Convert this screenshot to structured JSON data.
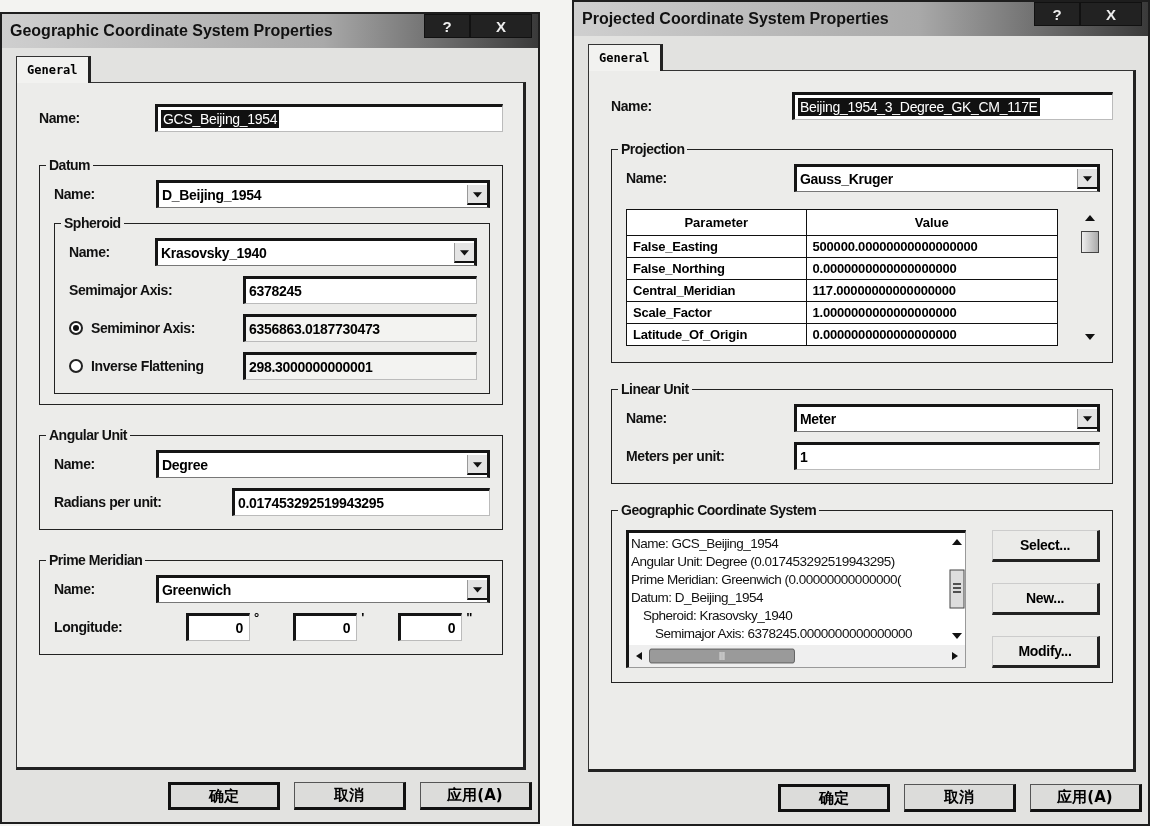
{
  "dialogs": [
    {
      "title": "Geographic Coordinate System Properties",
      "title_buttons": [
        "?",
        "X"
      ],
      "tabs": [
        {
          "label": "General",
          "selected": true
        }
      ],
      "name": {
        "label": "Name:",
        "value": "GCS_Beijing_1954",
        "text_selected": true
      },
      "groups": [
        {
          "title": "Datum",
          "rows": [
            {
              "kind": "dropdown",
              "label": "Name:",
              "value": "D_Beijing_1954"
            },
            {
              "kind": "group",
              "title": "Spheroid",
              "rows": [
                {
                  "kind": "dropdown",
                  "label": "Name:",
                  "value": "Krasovsky_1940"
                },
                {
                  "kind": "field",
                  "label": "Semimajor Axis:",
                  "value": "6378245"
                },
                {
                  "kind": "radio",
                  "label": "Semiminor Axis:",
                  "value": "6356863.0187730473",
                  "selected": true
                },
                {
                  "kind": "radio",
                  "label": "Inverse Flattening",
                  "value": "298.3000000000001",
                  "selected": false
                }
              ]
            }
          ]
        },
        {
          "title": "Angular Unit",
          "rows": [
            {
              "kind": "dropdown",
              "label": "Name:",
              "value": "Degree"
            },
            {
              "kind": "field",
              "label": "Radians per unit:",
              "value": "0.017453292519943295"
            }
          ]
        },
        {
          "title": "Prime Meridian",
          "rows": [
            {
              "kind": "dropdown",
              "label": "Name:",
              "value": "Greenwich"
            },
            {
              "kind": "dms",
              "label": "Longitude:",
              "fields": [
                {
                  "value": "0",
                  "unit": "°"
                },
                {
                  "value": "0",
                  "unit": "'"
                },
                {
                  "value": "0",
                  "unit": "\""
                }
              ]
            }
          ]
        }
      ],
      "buttons": [
        {
          "label": "确定",
          "default": true
        },
        {
          "label": "取消",
          "default": false
        },
        {
          "label": "应用(A)",
          "default": false
        }
      ]
    },
    {
      "title": "Projected Coordinate System Properties",
      "title_buttons": [
        "?",
        "X"
      ],
      "tabs": [
        {
          "label": "General",
          "selected": true
        }
      ],
      "name": {
        "label": "Name:",
        "value": "Beijing_1954_3_Degree_GK_CM_117E",
        "text_selected": true
      },
      "groups": [
        {
          "title": "Projection",
          "rows": [
            {
              "kind": "dropdown",
              "label": "Name:",
              "value": "Gauss_Kruger"
            },
            {
              "kind": "table",
              "columns": [
                "Parameter",
                "Value"
              ],
              "rows": [
                [
                  "False_Easting",
                  "500000.00000000000000000"
                ],
                [
                  "False_Northing",
                  "0.0000000000000000000"
                ],
                [
                  "Central_Meridian",
                  "117.00000000000000000"
                ],
                [
                  "Scale_Factor",
                  "1.0000000000000000000"
                ],
                [
                  "Latitude_Of_Origin",
                  "0.0000000000000000000"
                ]
              ]
            }
          ]
        },
        {
          "title": "Linear Unit",
          "rows": [
            {
              "kind": "dropdown",
              "label": "Name:",
              "value": "Meter"
            },
            {
              "kind": "field",
              "label": "Meters per unit:",
              "value": "1"
            }
          ]
        },
        {
          "title": "Geographic Coordinate System",
          "rows": [
            {
              "kind": "list",
              "lines": [
                {
                  "text": "Name: GCS_Beijing_1954"
                },
                {
                  "text": "Angular Unit: Degree (0.017453292519943295)"
                },
                {
                  "text": "Prime Meridian: Greenwich (0.00000000000000("
                },
                {
                  "text": "Datum: D_Beijing_1954",
                  "children": [
                    {
                      "text": "Spheroid: Krasovsky_1940",
                      "children": [
                        {
                          "text": "Semimajor Axis: 6378245.0000000000000000"
                        }
                      ]
                    }
                  ]
                }
              ],
              "side_buttons": [
                "Select...",
                "New...",
                "Modify..."
              ]
            }
          ]
        }
      ],
      "buttons": [
        {
          "label": "确定",
          "default": true
        },
        {
          "label": "取消",
          "default": false
        },
        {
          "label": "应用(A)",
          "default": false
        }
      ]
    }
  ]
}
